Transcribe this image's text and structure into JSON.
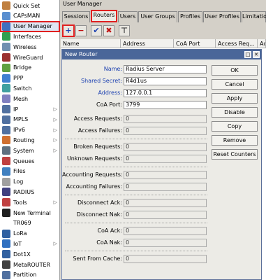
{
  "sidebar": {
    "items": [
      {
        "label": "Quick Set",
        "icon": "quick-set-icon",
        "color": "#c08040"
      },
      {
        "label": "CAPsMAN",
        "icon": "capsman-icon",
        "color": "#5a8fd0"
      },
      {
        "label": "User Manager",
        "icon": "user-manager-icon",
        "color": "#4070c0"
      },
      {
        "label": "Interfaces",
        "icon": "interfaces-icon",
        "color": "#30a050"
      },
      {
        "label": "Wireless",
        "icon": "wireless-icon",
        "color": "#7090b0"
      },
      {
        "label": "WireGuard",
        "icon": "wireguard-icon",
        "color": "#9a3030"
      },
      {
        "label": "Bridge",
        "icon": "bridge-icon",
        "color": "#60a040"
      },
      {
        "label": "PPP",
        "icon": "ppp-icon",
        "color": "#4080d0"
      },
      {
        "label": "Switch",
        "icon": "switch-icon",
        "color": "#40a0a0"
      },
      {
        "label": "Mesh",
        "icon": "mesh-icon",
        "color": "#8080c0"
      },
      {
        "label": "IP",
        "icon": "ip-icon",
        "color": "#5070a0",
        "arrow": "▷"
      },
      {
        "label": "MPLS",
        "icon": "mpls-icon",
        "color": "#5070a0",
        "arrow": "▷"
      },
      {
        "label": "IPv6",
        "icon": "ipv6-icon",
        "color": "#5070a0",
        "arrow": "▷"
      },
      {
        "label": "Routing",
        "icon": "routing-icon",
        "color": "#d07030",
        "arrow": "▷"
      },
      {
        "label": "System",
        "icon": "system-icon",
        "color": "#607080",
        "arrow": "▷"
      },
      {
        "label": "Queues",
        "icon": "queues-icon",
        "color": "#c04040"
      },
      {
        "label": "Files",
        "icon": "files-icon",
        "color": "#4080c0"
      },
      {
        "label": "Log",
        "icon": "log-icon",
        "color": "#a0a0a0"
      },
      {
        "label": "RADIUS",
        "icon": "radius-icon",
        "color": "#404080"
      },
      {
        "label": "Tools",
        "icon": "tools-icon",
        "color": "#c04040",
        "arrow": "▷"
      },
      {
        "label": "New Terminal",
        "icon": "terminal-icon",
        "color": "#202020"
      },
      {
        "label": "TR069",
        "icon": "",
        "color": ""
      },
      {
        "label": "LoRa",
        "icon": "lora-icon",
        "color": "#3060a0"
      },
      {
        "label": "IoT",
        "icon": "iot-icon",
        "color": "#3070c0",
        "arrow": "▷"
      },
      {
        "label": "Dot1X",
        "icon": "dot1x-icon",
        "color": "#3060a0"
      },
      {
        "label": "MetaROUTER",
        "icon": "metarouter-icon",
        "color": "#404040"
      },
      {
        "label": "Partition",
        "icon": "partition-icon",
        "color": "#5070a0"
      }
    ],
    "selected_index": 2
  },
  "window": {
    "title": "User Manager",
    "tabs": [
      "Sessions",
      "Routers",
      "Users",
      "User Groups",
      "Profiles",
      "User Profiles",
      "Limitatio"
    ],
    "active_tab": 1,
    "toolbar": {
      "add": "+",
      "remove": "−",
      "enable": "✔",
      "disable": "✖",
      "filter": "⊤"
    },
    "columns": [
      "Name",
      "Address",
      "CoA Port",
      "Access Req...",
      "Ac"
    ]
  },
  "dialog": {
    "title": "New Router",
    "fields": {
      "name": {
        "label": "Name:",
        "value": "Radius Server"
      },
      "secret": {
        "label": "Shared Secret:",
        "value": "R4d1us"
      },
      "address": {
        "label": "Address:",
        "value": "127.0.0.1"
      },
      "coa_port": {
        "label": "CoA Port:",
        "value": "3799"
      }
    },
    "stats": [
      {
        "label": "Access Requests:",
        "value": "0"
      },
      {
        "label": "Access Failures:",
        "value": "0"
      },
      {
        "label": "Broken Requests:",
        "value": "0"
      },
      {
        "label": "Unknown Requests:",
        "value": "0"
      },
      {
        "label": "Accounting Requests:",
        "value": "0"
      },
      {
        "label": "Accounting Failures:",
        "value": "0"
      },
      {
        "label": "Disconnect Ack:",
        "value": "0"
      },
      {
        "label": "Disconnect Nak:",
        "value": "0"
      },
      {
        "label": "CoA Ack:",
        "value": "0"
      },
      {
        "label": "CoA Nak:",
        "value": "0"
      },
      {
        "label": "Sent From Cache:",
        "value": "0"
      }
    ],
    "buttons": {
      "ok": "OK",
      "cancel": "Cancel",
      "apply": "Apply",
      "disable": "Disable",
      "copy": "Copy",
      "remove": "Remove",
      "reset": "Reset Counters"
    },
    "status": "enabled"
  }
}
